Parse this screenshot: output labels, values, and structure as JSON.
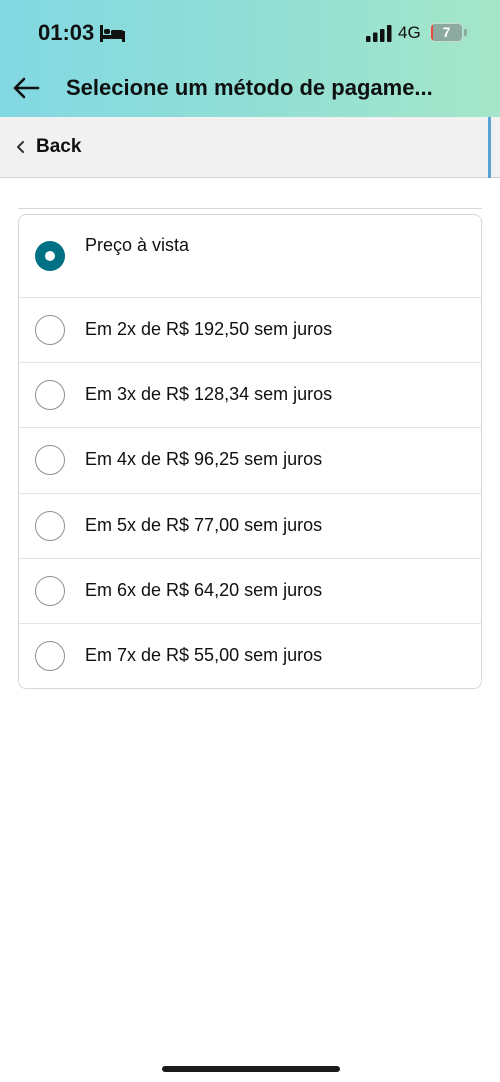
{
  "status_bar": {
    "time": "01:03",
    "network": "4G",
    "battery": "7",
    "battery_level_percent": 7
  },
  "header": {
    "title": "Selecione um método de pagame..."
  },
  "back_bar": {
    "label": "Back"
  },
  "options": [
    {
      "label": "Preço à vista",
      "selected": true
    },
    {
      "label": "Em 2x de R$ 192,50 sem juros",
      "selected": false
    },
    {
      "label": "Em 3x de R$ 128,34 sem juros",
      "selected": false
    },
    {
      "label": "Em 4x de R$ 96,25 sem juros",
      "selected": false
    },
    {
      "label": "Em 5x de R$ 77,00 sem juros",
      "selected": false
    },
    {
      "label": "Em 6x de R$ 64,20 sem juros",
      "selected": false
    },
    {
      "label": "Em 7x de R$ 55,00 sem juros",
      "selected": false
    }
  ],
  "colors": {
    "accent": "#007185",
    "header_gradient_start": "#82d8e3",
    "header_gradient_end": "#a5e6c9"
  },
  "icons": {
    "sleep": "bed-icon",
    "signal": "cellular-signal-icon",
    "back": "arrow-left-icon",
    "back_chevron": "chevron-left-icon"
  }
}
